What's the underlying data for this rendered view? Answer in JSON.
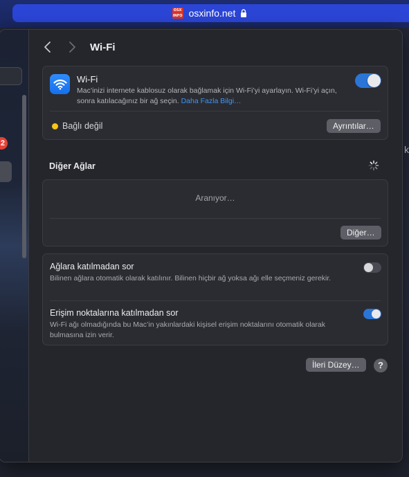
{
  "browser": {
    "url": "osxinfo.net",
    "favicon_text": "OSX INFO"
  },
  "background": {
    "edge_text": "ke"
  },
  "sidebar": {
    "badge_count": "2"
  },
  "toolbar": {
    "title": "Wi-Fi"
  },
  "wifi_card": {
    "title": "Wi-Fi",
    "description": "Mac’inizi internete kablosuz olarak bağlamak için Wi-Fi’yi ayarlayın. Wi-Fi’yi açın, sonra katılacağınız bir ağ seçin.",
    "link": "Daha Fazla Bilgi…",
    "toggle_on": true,
    "status": "Bağlı değil",
    "status_color": "#f5c518",
    "details_button": "Ayrıntılar…"
  },
  "other_networks": {
    "title": "Diğer Ağlar",
    "searching": "Aranıyor…",
    "other_button": "Diğer…"
  },
  "options": [
    {
      "title": "Ağlara katılmadan sor",
      "description": "Bilinen ağlara otomatik olarak katılınır. Bilinen hiçbir ağ yoksa ağı elle seçmeniz gerekir.",
      "enabled": false
    },
    {
      "title": "Erişim noktalarına katılmadan sor",
      "description": "Wi-Fi ağı olmadığında bu Mac’in yakınlardaki kişisel erişim noktalarını otomatik olarak bulmasına izin verir.",
      "enabled": true
    }
  ],
  "footer": {
    "advanced_button": "İleri Düzey…",
    "help_button": "?"
  },
  "colors": {
    "accent": "#2b75d6",
    "link": "#3e96f9",
    "badge": "#e5433a"
  }
}
